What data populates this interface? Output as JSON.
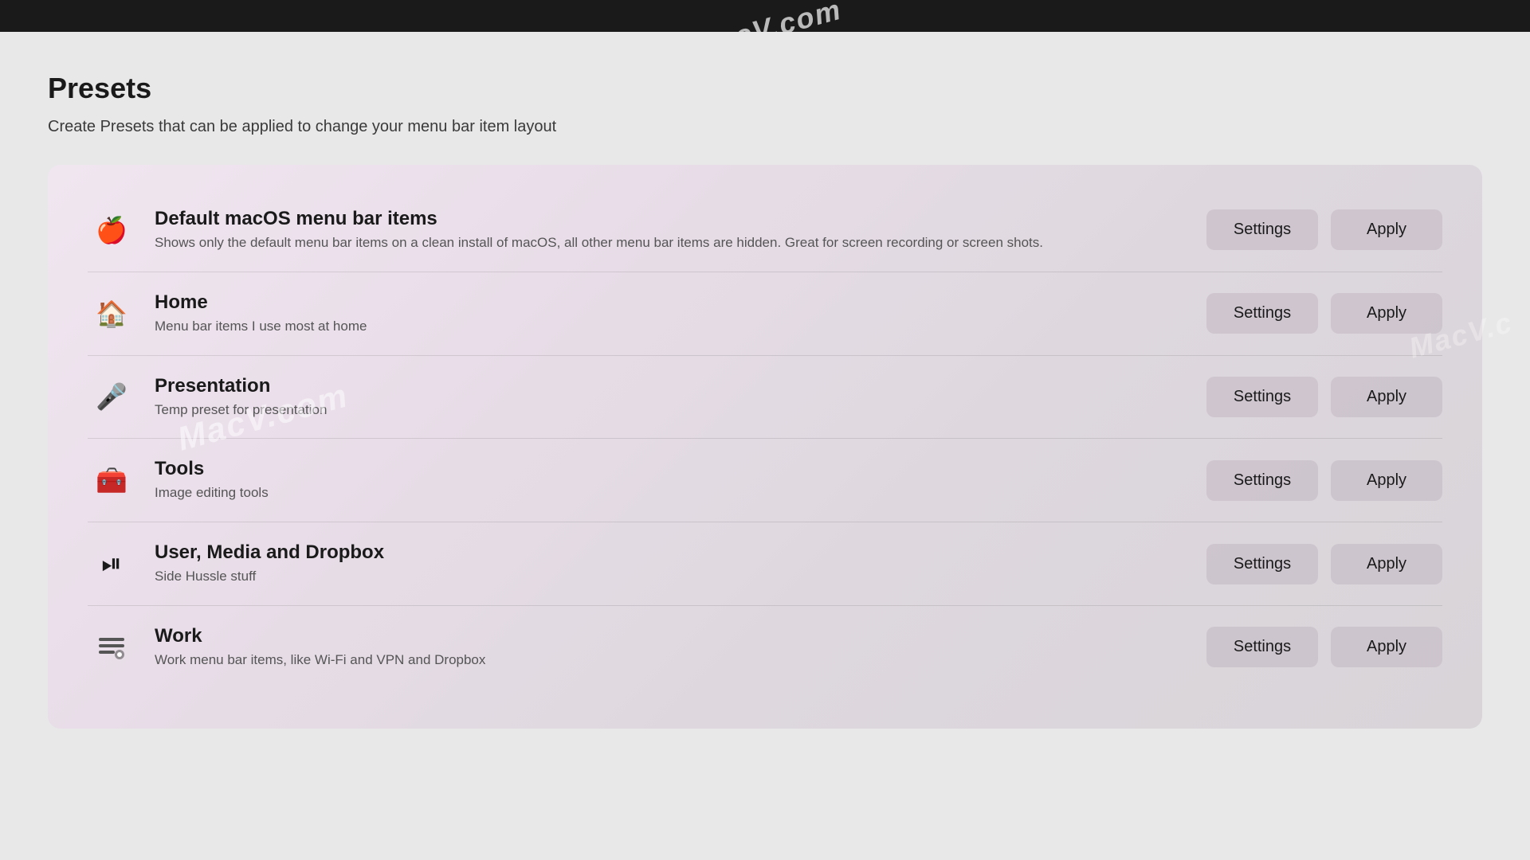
{
  "topBar": {
    "watermark": "MacV.com"
  },
  "page": {
    "title": "Presets",
    "subtitle": "Create Presets that can be applied to change your menu bar item layout"
  },
  "presets": [
    {
      "id": "default-macos",
      "icon": "🍎",
      "name": "Default macOS menu bar items",
      "description": "Shows only the default menu bar items on a clean install of macOS, all other menu bar items are hidden. Great for screen recording or screen shots.",
      "settingsLabel": "Settings",
      "applyLabel": "Apply"
    },
    {
      "id": "home",
      "icon": "🏠",
      "name": "Home",
      "description": "Menu bar items I use most at home",
      "settingsLabel": "Settings",
      "applyLabel": "Apply"
    },
    {
      "id": "presentation",
      "icon": "🎤",
      "name": "Presentation",
      "description": "Temp preset for presentation",
      "settingsLabel": "Settings",
      "applyLabel": "Apply"
    },
    {
      "id": "tools",
      "icon": "🧰",
      "name": "Tools",
      "description": "Image editing tools",
      "settingsLabel": "Settings",
      "applyLabel": "Apply"
    },
    {
      "id": "user-media-dropbox",
      "icon": "⏯",
      "name": "User, Media and Dropbox",
      "description": "Side Hussle stuff",
      "settingsLabel": "Settings",
      "applyLabel": "Apply"
    },
    {
      "id": "work",
      "icon": "📋",
      "name": "Work",
      "description": "Work menu bar items, like Wi-Fi and VPN and Dropbox",
      "settingsLabel": "Settings",
      "applyLabel": "Apply"
    }
  ],
  "watermarks": {
    "text1": "MacV.com",
    "text2": "MacV.c"
  }
}
